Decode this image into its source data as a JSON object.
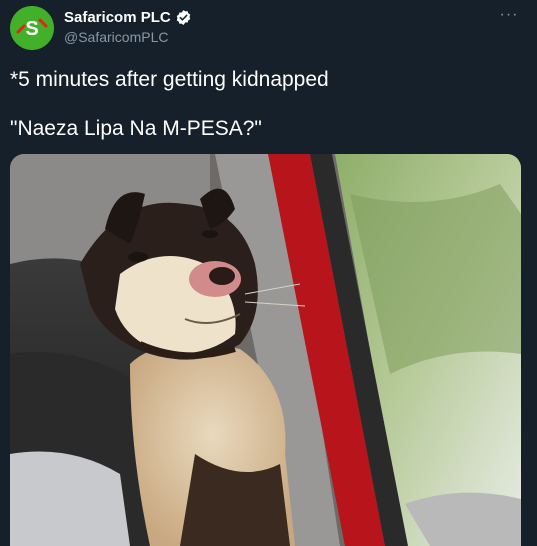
{
  "account": {
    "display_name": "Safaricom PLC",
    "handle": "@SafaricomPLC",
    "avatar_letter": "S",
    "avatar_color": "#43b02a",
    "verified_icon": "verified-badge-icon"
  },
  "menu": {
    "more_label": "···"
  },
  "tweet": {
    "line1": "*5 minutes after getting kidnapped",
    "line2": "\"Naeza Lipa Na M-PESA?\""
  },
  "media": {
    "alt_icon": "photo-dog-in-car"
  },
  "colors": {
    "background": "#15202b",
    "text": "#ffffff",
    "secondary_text": "#8899a6",
    "brand_green": "#43b02a"
  }
}
